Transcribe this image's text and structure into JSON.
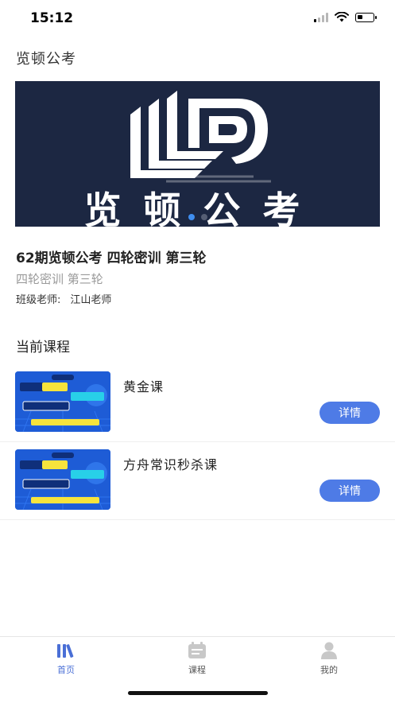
{
  "status_bar": {
    "time": "15:12"
  },
  "header": {
    "title": "览顿公考"
  },
  "banner": {
    "logo_text": "览顿公考",
    "slides": 2,
    "active_slide": 0
  },
  "course": {
    "title": "62期览顿公考 四轮密训 第三轮",
    "subtitle": "四轮密训 第三轮",
    "teacher_label": "班级老师:",
    "teacher_name": "江山老师"
  },
  "current_section": {
    "title": "当前课程"
  },
  "lessons": [
    {
      "name": "黄金课",
      "button": "详情"
    },
    {
      "name": "方舟常识秒杀课",
      "button": "详情"
    }
  ],
  "tab_bar": {
    "items": [
      {
        "label": "首页",
        "icon": "books-icon",
        "active": true
      },
      {
        "label": "课程",
        "icon": "calendar-icon",
        "active": false
      },
      {
        "label": "我的",
        "icon": "person-icon",
        "active": false
      }
    ]
  },
  "colors": {
    "accent": "#4e7be6",
    "banner_bg": "#1c2742",
    "tab_active": "#4a6fd6"
  }
}
